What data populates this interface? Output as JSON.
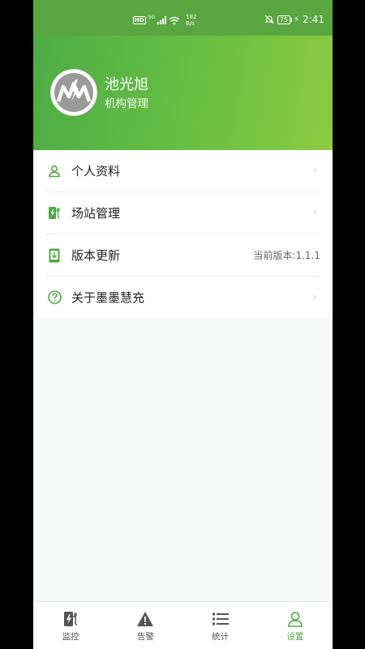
{
  "status_bar": {
    "hd": "HD",
    "network": "5G",
    "speed_value": "182",
    "speed_unit": "B/s",
    "battery": "75",
    "time": "2:41"
  },
  "profile": {
    "name": "池光旭",
    "role": "机构管理"
  },
  "menu": {
    "items": [
      {
        "label": "个人资料",
        "icon": "person-icon"
      },
      {
        "label": "场站管理",
        "icon": "charging-station-icon"
      },
      {
        "label": "版本更新",
        "icon": "phone-download-icon",
        "value": "当前版本:1.1.1"
      },
      {
        "label": "关于墨墨慧充",
        "icon": "help-circle-icon"
      }
    ]
  },
  "tabbar": {
    "tabs": [
      {
        "label": "监控",
        "icon": "charger-icon"
      },
      {
        "label": "告警",
        "icon": "warning-icon"
      },
      {
        "label": "统计",
        "icon": "list-icon"
      },
      {
        "label": "设置",
        "icon": "user-settings-icon",
        "active": true
      }
    ]
  },
  "colors": {
    "accent": "#4aab3e",
    "header_start": "#4cad45",
    "header_end": "#8ccb3f"
  }
}
